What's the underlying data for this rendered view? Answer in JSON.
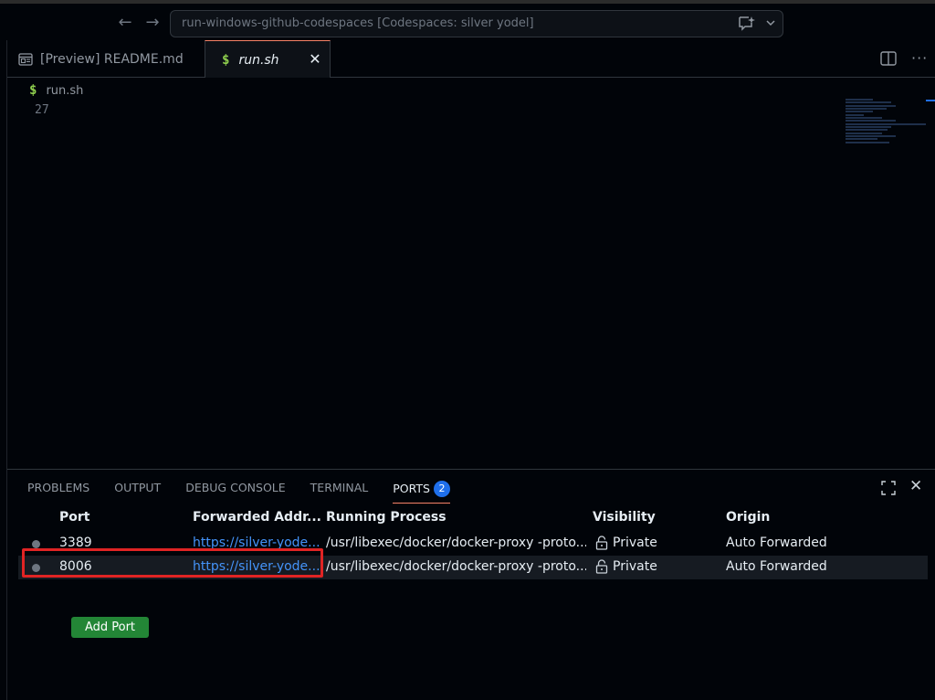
{
  "titlebar": {
    "back_icon": "arrow-left-icon",
    "forward_icon": "arrow-right-icon",
    "command_center_text": "run-windows-github-codespaces [Codespaces: silver yodel]",
    "chat_icon": "chat-sparkle-icon",
    "dropdown_icon": "chevron-down-icon"
  },
  "tabs": [
    {
      "label": "[Preview] README.md",
      "icon": "preview-icon",
      "active": false
    },
    {
      "label": "run.sh",
      "icon": "dollar-icon",
      "active": true,
      "close": "✕"
    }
  ],
  "editor": {
    "breadcrumb_file": "run.sh",
    "dollar": "$",
    "line_number": "27"
  },
  "panel": {
    "tabs": [
      {
        "label": "PROBLEMS"
      },
      {
        "label": "OUTPUT"
      },
      {
        "label": "DEBUG CONSOLE"
      },
      {
        "label": "TERMINAL"
      },
      {
        "label": "PORTS",
        "badge": "2",
        "active": true
      }
    ],
    "close": "✕"
  },
  "ports": {
    "columns": [
      "Port",
      "Forwarded Addr...",
      "Running Process",
      "Visibility",
      "Origin"
    ],
    "rows": [
      {
        "port": "3389",
        "address": "https://silver-yode...",
        "process": "/usr/libexec/docker/docker-proxy -proto...",
        "visibility": "Private",
        "origin": "Auto Forwarded"
      },
      {
        "port": "8006",
        "address": "https://silver-yode...",
        "process": "/usr/libexec/docker/docker-proxy -proto...",
        "visibility": "Private",
        "origin": "Auto Forwarded"
      }
    ],
    "add_button": "Add Port"
  },
  "colors": {
    "background": "#010409",
    "accent_link": "#4493f8",
    "badge": "#1f6feb",
    "button_green": "#238636",
    "highlight_red": "#e02424",
    "tab_active_border": "#f78166"
  }
}
